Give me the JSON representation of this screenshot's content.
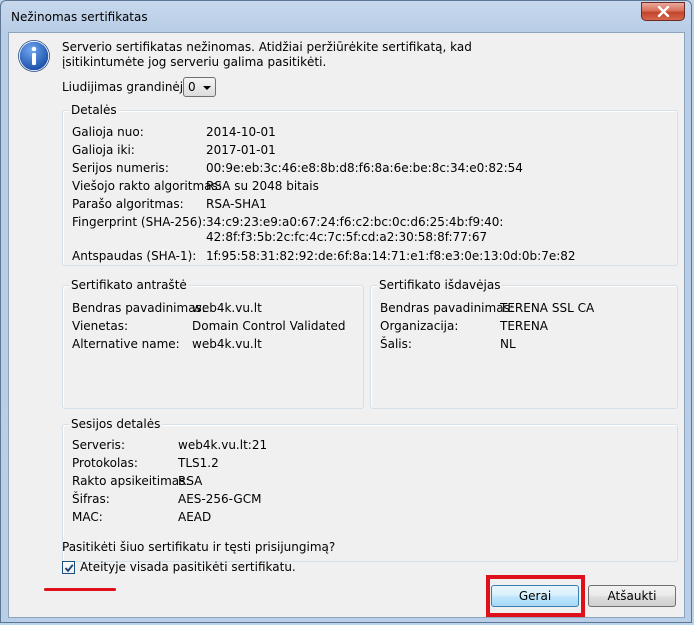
{
  "window": {
    "title": "Nežinomas sertifikatas"
  },
  "message": {
    "line1": "Serverio sertifikatas nežinomas. Atidžiai peržiūrėkite sertifikatą, kad",
    "line2": "įsitikintumėte jog serveriu galima pasitikėti."
  },
  "chain": {
    "label": "Liudijimas grandinėje:",
    "value": "0"
  },
  "details": {
    "legend": "Detalės",
    "valid_from_label": "Galioja nuo:",
    "valid_from": "2014-10-01",
    "valid_to_label": "Galioja iki:",
    "valid_to": "2017-01-01",
    "serial_label": "Serijos numeris:",
    "serial": "00:9e:eb:3c:46:e8:8b:d8:f6:8a:6e:be:8c:34:e0:82:54",
    "pubkey_label": "Viešojo rakto algoritmas:",
    "pubkey": "RSA su 2048 bitais",
    "sigalg_label": "Parašo algoritmas:",
    "sigalg": "RSA-SHA1",
    "sha256_label": "Fingerprint (SHA-256):",
    "sha256_line1": "34:c9:23:e9:a0:67:24:f6:c2:bc:0c:d6:25:4b:f9:40:",
    "sha256_line2": "42:8f:f3:5b:2c:fc:4c:7c:5f:cd:a2:30:58:8f:77:67",
    "sha1_label": "Antspaudas (SHA-1):",
    "sha1": "1f:95:58:31:82:92:de:6f:8a:14:71:e1:f8:e3:0e:13:0d:0b:7e:82"
  },
  "subject": {
    "legend": "Sertifikato antraštė",
    "cn_label": "Bendras pavadinimas:",
    "cn": "web4k.vu.lt",
    "ou_label": "Vienetas:",
    "ou": "Domain Control Validated",
    "alt_label": "Alternative name:",
    "alt": "web4k.vu.lt"
  },
  "issuer": {
    "legend": "Sertifikato išdavėjas",
    "cn_label": "Bendras pavadinimas:",
    "cn": "TERENA SSL CA",
    "org_label": "Organizacija:",
    "org": "TERENA",
    "country_label": "Šalis:",
    "country": "NL"
  },
  "session": {
    "legend": "Sesijos detalės",
    "server_label": "Serveris:",
    "server": "web4k.vu.lt:21",
    "protocol_label": "Protokolas:",
    "protocol": "TLS1.2",
    "kex_label": "Rakto apsikeitimas:",
    "kex": "RSA",
    "cipher_label": "Šifras:",
    "cipher": "AES-256-GCM",
    "mac_label": "MAC:",
    "mac": "AEAD"
  },
  "question": "Pasitikėti šiuo sertifikatu ir tęsti prisijungimą?",
  "always_trust": {
    "label": "Ateityje visada pasitikėti sertifikatu.",
    "checked": true
  },
  "buttons": {
    "ok": "Gerai",
    "cancel": "Atšaukti"
  },
  "colors": {
    "highlight": "#e0101a",
    "titlebar": "#b9cee7",
    "dialog_bg": "#f0f0f0"
  }
}
